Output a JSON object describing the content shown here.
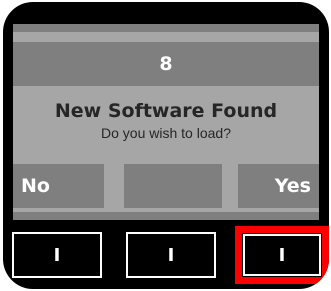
{
  "screen": {
    "title": "8",
    "headline": "New Software Found",
    "question": "Do you wish to load?"
  },
  "softkeys": {
    "left_label": "No",
    "middle_label": "",
    "right_label": "Yes"
  },
  "hardware_buttons": [
    {
      "label": "I"
    },
    {
      "label": "I"
    },
    {
      "label": "I",
      "highlighted": true
    }
  ],
  "colors": {
    "device_body": "#000000",
    "screen_bg": "#a6a6a6",
    "bar_bg": "#7f7f7f",
    "highlight": "#ff0000"
  }
}
